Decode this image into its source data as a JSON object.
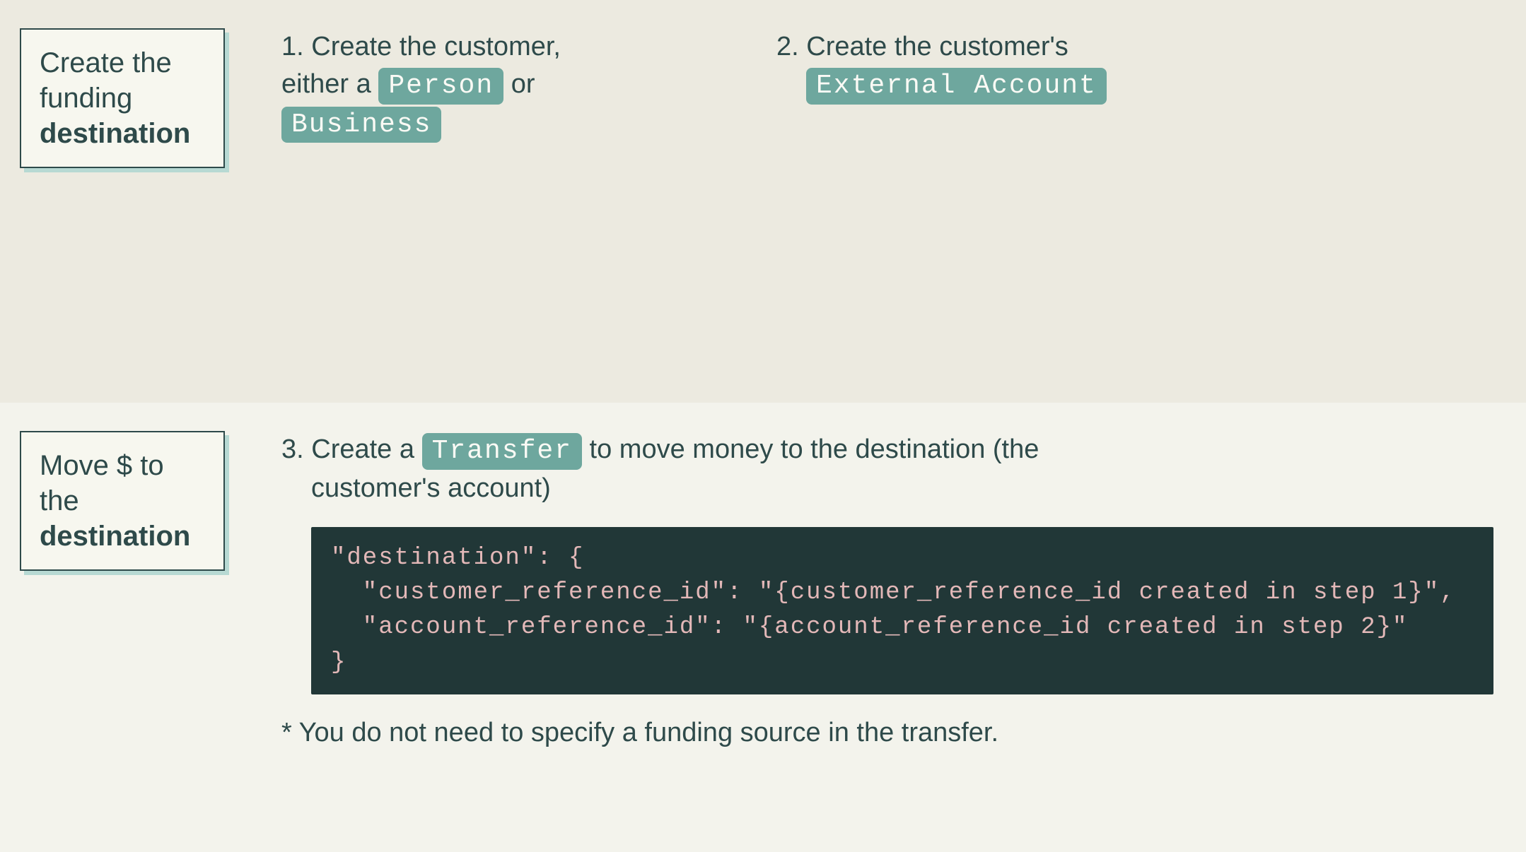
{
  "top": {
    "label": {
      "line1": "Create the",
      "line2": "funding",
      "line3_bold": "destination"
    },
    "step1": {
      "part1": "1. Create the customer,",
      "part2_prefix": "either a ",
      "chip_person": "Person",
      "part2_mid": " or",
      "chip_business": "Business"
    },
    "step2": {
      "part1": "2. Create the customer's",
      "chip_external_account": "External Account"
    }
  },
  "bottom": {
    "label": {
      "line1": "Move $ to",
      "line2": "the",
      "line3_bold": "destination"
    },
    "step3": {
      "prefix": "3. Create a ",
      "chip_transfer": "Transfer",
      "mid": " to move money to the destination (the",
      "line2": "customer's account)"
    },
    "code": {
      "l1": "\"destination\": {",
      "l2": "  \"customer_reference_id\": \"{customer_reference_id created in step 1}\",",
      "l3": "  \"account_reference_id\": \"{account_reference_id created in step 2}\"",
      "l4": "}"
    },
    "footnote": "* You do not need to specify a funding source in the transfer."
  }
}
